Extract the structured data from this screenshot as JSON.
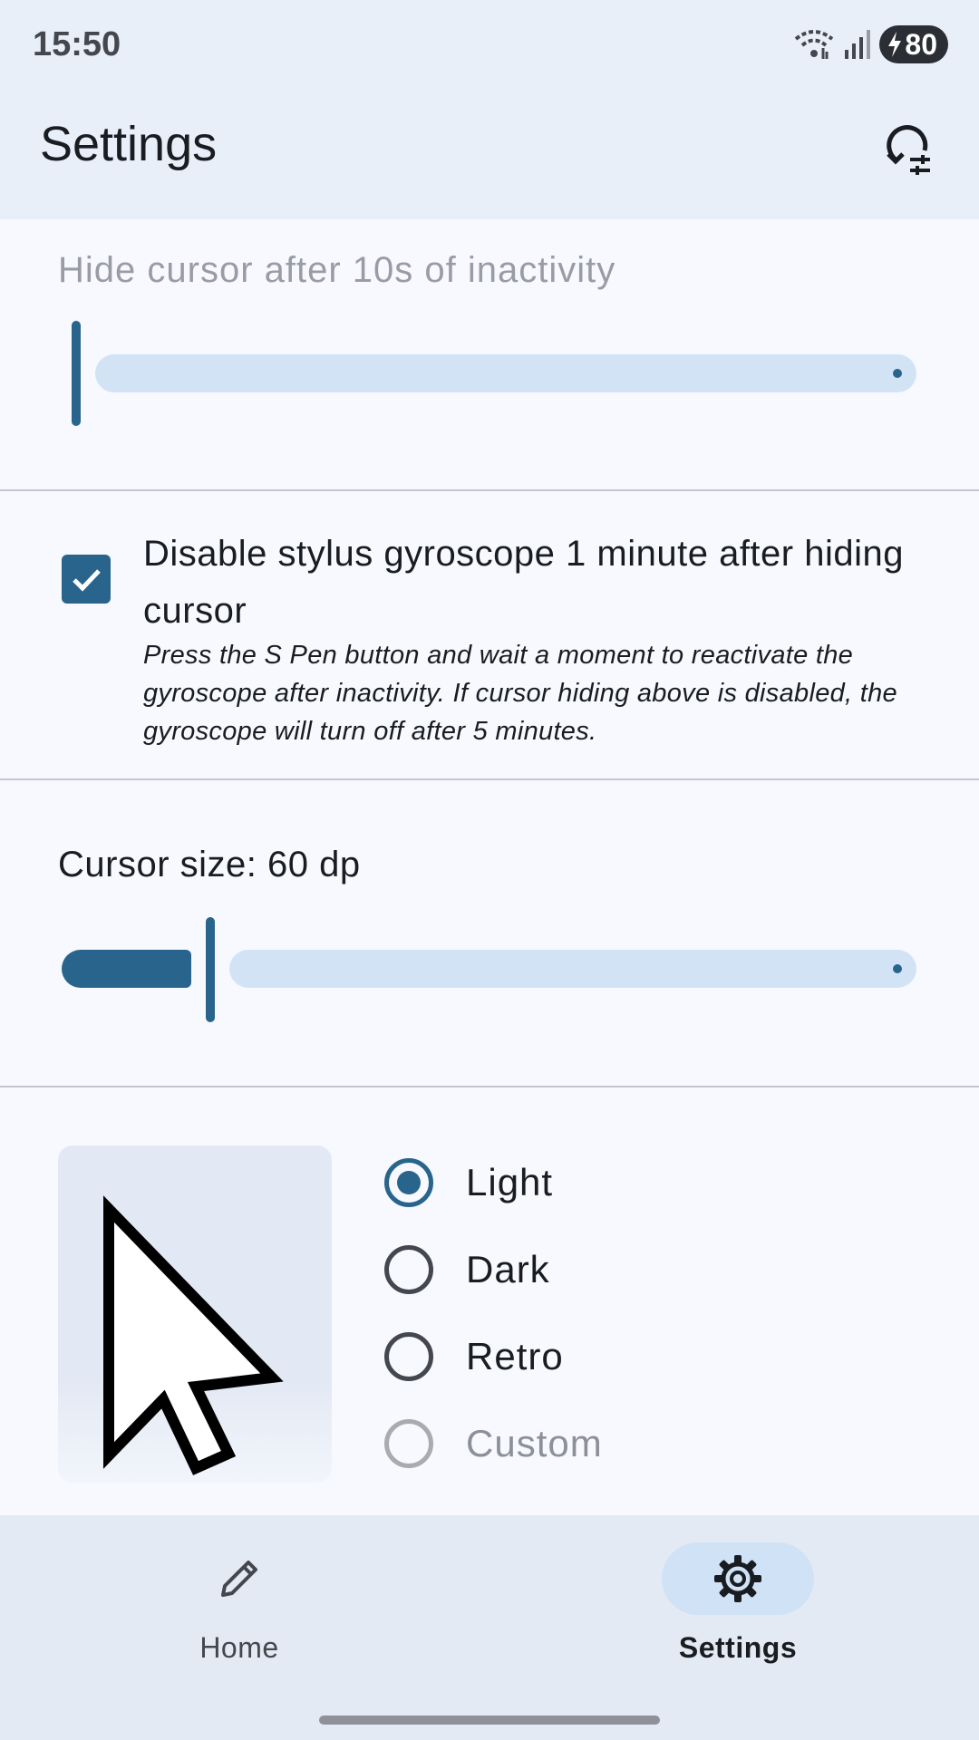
{
  "status_bar": {
    "time": "15:50",
    "battery": "80"
  },
  "app_bar": {
    "title": "Settings"
  },
  "hide_cursor": {
    "label": "Hide cursor after 10s of inactivity",
    "slider_value_fraction": 0.0
  },
  "gyroscope": {
    "checked": true,
    "title": "Disable stylus gyroscope 1 minute after hiding cursor",
    "description": "Press the S Pen button and wait a moment to reactivate the gyroscope after inactivity. If cursor hiding above is disabled, the gyroscope will turn off after 5 minutes."
  },
  "cursor_size": {
    "label": "Cursor size: 60 dp",
    "slider_value_fraction": 0.17
  },
  "cursor_style": {
    "options": [
      {
        "label": "Light",
        "selected": true,
        "enabled": true
      },
      {
        "label": "Dark",
        "selected": false,
        "enabled": true
      },
      {
        "label": "Retro",
        "selected": false,
        "enabled": true
      },
      {
        "label": "Custom",
        "selected": false,
        "enabled": false
      }
    ]
  },
  "bottom_nav": {
    "items": [
      {
        "label": "Home",
        "icon": "pencil-icon",
        "active": false
      },
      {
        "label": "Settings",
        "icon": "gear-icon",
        "active": true
      }
    ]
  },
  "colors": {
    "primary": "#29648c",
    "track_inactive": "#d3e3f6",
    "surface": "#f7f9ff",
    "app_bar": "#e9eff9"
  }
}
